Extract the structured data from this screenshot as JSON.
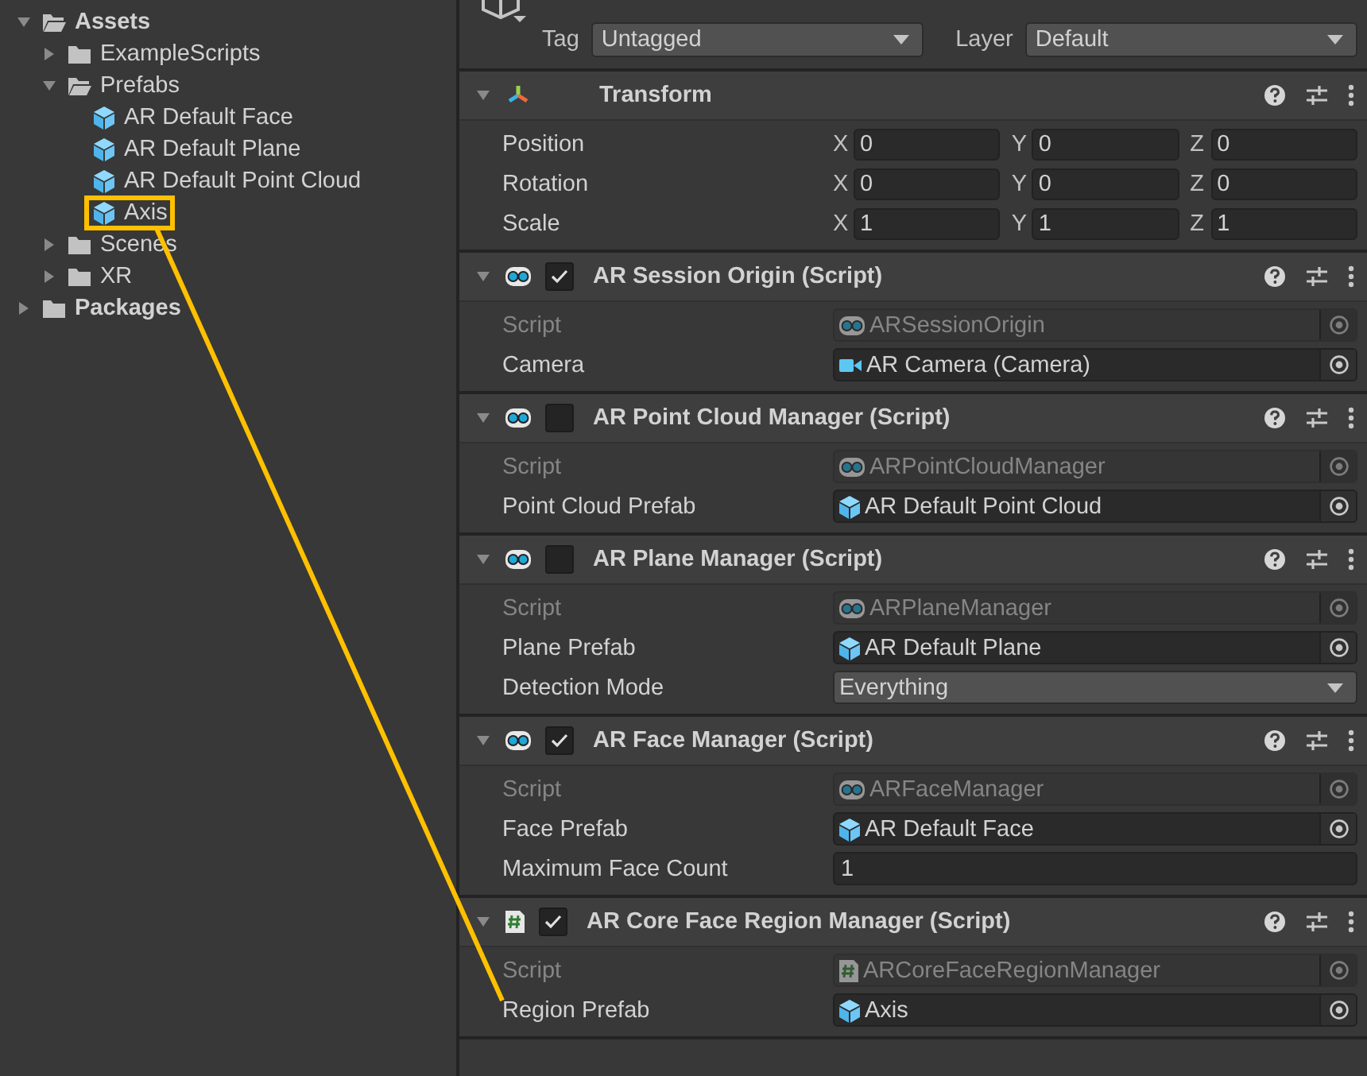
{
  "project_tree": [
    {
      "label": "Assets",
      "kind": "folder",
      "expanded": true,
      "children": [
        {
          "label": "ExampleScripts",
          "kind": "folder",
          "expanded": false
        },
        {
          "label": "Prefabs",
          "kind": "folder",
          "expanded": true,
          "children": [
            {
              "label": "AR Default Face",
              "kind": "prefab"
            },
            {
              "label": "AR Default Plane",
              "kind": "prefab"
            },
            {
              "label": "AR Default Point Cloud",
              "kind": "prefab"
            },
            {
              "label": "Axis",
              "kind": "prefab",
              "annotated": true
            }
          ]
        },
        {
          "label": "Scenes",
          "kind": "folder",
          "expanded": false
        },
        {
          "label": "XR",
          "kind": "folder",
          "expanded": false
        }
      ]
    },
    {
      "label": "Packages",
      "kind": "folder",
      "expanded": false
    }
  ],
  "inspector": {
    "tag_label": "Tag",
    "tag": "Untagged",
    "layer_label": "Layer",
    "layer": "Default",
    "components": [
      {
        "title": "Transform",
        "kind": "transform",
        "rows": [
          {
            "kind": "vector",
            "label": "Position",
            "axes": [
              {
                "axis": "X",
                "value": "0"
              },
              {
                "axis": "Y",
                "value": "0"
              },
              {
                "axis": "Z",
                "value": "0"
              }
            ]
          },
          {
            "kind": "vector",
            "label": "Rotation",
            "axes": [
              {
                "axis": "X",
                "value": "0"
              },
              {
                "axis": "Y",
                "value": "0"
              },
              {
                "axis": "Z",
                "value": "0"
              }
            ]
          },
          {
            "kind": "vector",
            "label": "Scale",
            "axes": [
              {
                "axis": "X",
                "value": "1"
              },
              {
                "axis": "Y",
                "value": "1"
              },
              {
                "axis": "Z",
                "value": "1"
              }
            ]
          }
        ]
      },
      {
        "title": "AR Session Origin (Script)",
        "kind": "ar_script",
        "enabled": true,
        "rows": [
          {
            "kind": "ar_script_ref",
            "label": "Script",
            "value": "ARSessionOrigin",
            "disabled": true
          },
          {
            "kind": "camera_ref",
            "label": "Camera",
            "value": "AR Camera (Camera)",
            "disabled": false
          }
        ]
      },
      {
        "title": "AR Point Cloud Manager (Script)",
        "kind": "ar_script",
        "enabled": false,
        "rows": [
          {
            "kind": "ar_script_ref",
            "label": "Script",
            "value": "ARPointCloudManager",
            "disabled": true
          },
          {
            "kind": "prefab_ref",
            "label": "Point Cloud Prefab",
            "value": "AR Default Point Cloud",
            "disabled": false
          }
        ]
      },
      {
        "title": "AR Plane Manager (Script)",
        "kind": "ar_script",
        "enabled": false,
        "rows": [
          {
            "kind": "ar_script_ref",
            "label": "Script",
            "value": "ARPlaneManager",
            "disabled": true
          },
          {
            "kind": "prefab_ref",
            "label": "Plane Prefab",
            "value": "AR Default Plane",
            "disabled": false
          },
          {
            "kind": "dropdown",
            "label": "Detection Mode",
            "value": "Everything"
          }
        ]
      },
      {
        "title": "AR Face Manager (Script)",
        "kind": "ar_script",
        "enabled": true,
        "rows": [
          {
            "kind": "ar_script_ref",
            "label": "Script",
            "value": "ARFaceManager",
            "disabled": true
          },
          {
            "kind": "prefab_ref",
            "label": "Face Prefab",
            "value": "AR Default Face",
            "disabled": false
          },
          {
            "kind": "text",
            "label": "Maximum Face Count",
            "value": "1"
          }
        ]
      },
      {
        "title": "AR Core Face Region Manager (Script)",
        "kind": "csharp_script",
        "enabled": true,
        "rows": [
          {
            "kind": "csharp_script_ref",
            "label": "Script",
            "value": "ARCoreFaceRegionManager",
            "disabled": true
          },
          {
            "kind": "prefab_ref",
            "label": "Region Prefab",
            "value": "Axis",
            "disabled": false,
            "annotated": true
          }
        ]
      }
    ]
  }
}
